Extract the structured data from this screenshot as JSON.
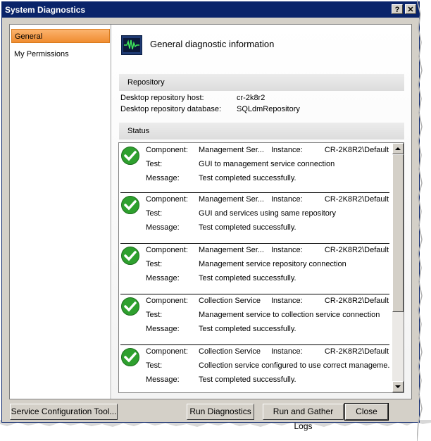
{
  "window": {
    "title": "System Diagnostics",
    "help_label": "?",
    "close_label": "✕"
  },
  "nav": {
    "items": [
      {
        "label": "General",
        "active": true
      },
      {
        "label": "My Permissions",
        "active": false
      }
    ]
  },
  "header": {
    "title": "General diagnostic information",
    "icon": "monitor-waveform-icon"
  },
  "repository": {
    "section_label": "Repository",
    "host_label": "Desktop repository host:",
    "host_value": "cr-2k8r2",
    "database_label": "Desktop repository database:",
    "database_value": "SQLdmRepository"
  },
  "status": {
    "section_label": "Status",
    "field_labels": {
      "component": "Component:",
      "instance": "Instance:",
      "test": "Test:",
      "message": "Message:"
    },
    "rows": [
      {
        "component": "Management Ser...",
        "instance": "CR-2K8R2\\Default",
        "test": "GUI to management service connection",
        "message": "Test completed successfully."
      },
      {
        "component": "Management Ser...",
        "instance": "CR-2K8R2\\Default",
        "test": "GUI and services using same repository",
        "message": "Test completed successfully."
      },
      {
        "component": "Management Ser...",
        "instance": "CR-2K8R2\\Default",
        "test": "Management service repository connection",
        "message": "Test completed successfully."
      },
      {
        "component": "Collection Service",
        "instance": "CR-2K8R2\\Default",
        "test": "Management service to collection service connection",
        "message": "Test completed successfully."
      },
      {
        "component": "Collection Service",
        "instance": "CR-2K8R2\\Default",
        "test": "Collection service configured to use correct manageme...",
        "message": "Test completed successfully."
      }
    ]
  },
  "buttons": {
    "service_config": "Service Configuration Tool...",
    "run_diagnostics": "Run Diagnostics",
    "run_gather_logs": "Run and Gather Logs",
    "close": "Close"
  },
  "colors": {
    "title_bar": "#0a246a",
    "nav_active": "#f5a04e",
    "check_green": "#2ea02e"
  }
}
